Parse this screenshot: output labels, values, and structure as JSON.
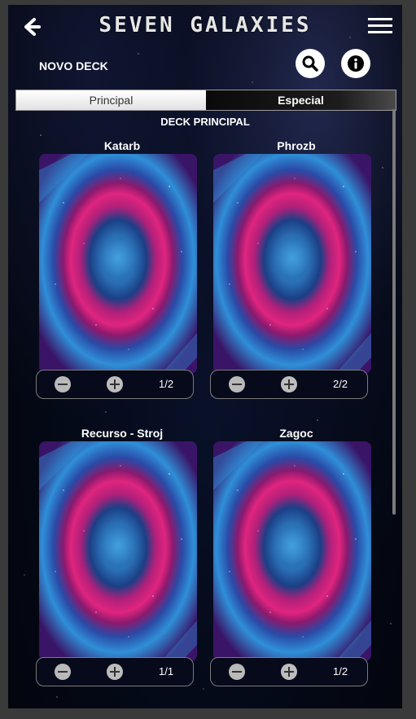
{
  "app": {
    "title": "SEVEN GALAXIES",
    "back_icon": "back-chevron-icon",
    "menu_icon": "hamburger-menu-icon"
  },
  "deck": {
    "name": "NOVO DECK",
    "search_icon": "search-icon",
    "info_icon": "info-icon"
  },
  "tabs": [
    {
      "label": "Principal",
      "selected": false
    },
    {
      "label": "Especial",
      "selected": true
    }
  ],
  "section": {
    "title": "DECK PRINCIPAL"
  },
  "cards": [
    {
      "name": "Katarb",
      "count": "1/2"
    },
    {
      "name": "Phrozb",
      "count": "2/2"
    },
    {
      "name": "Recurso - Stroj",
      "count": "1/1"
    },
    {
      "name": "Zagoc",
      "count": "1/2"
    }
  ],
  "colors": {
    "background": "#02040a",
    "nebula_pink": "#e0247e",
    "nebula_blue": "#2f8fd8",
    "nebula_purple": "#3a1466",
    "counter_border": "#7b7b7b"
  }
}
